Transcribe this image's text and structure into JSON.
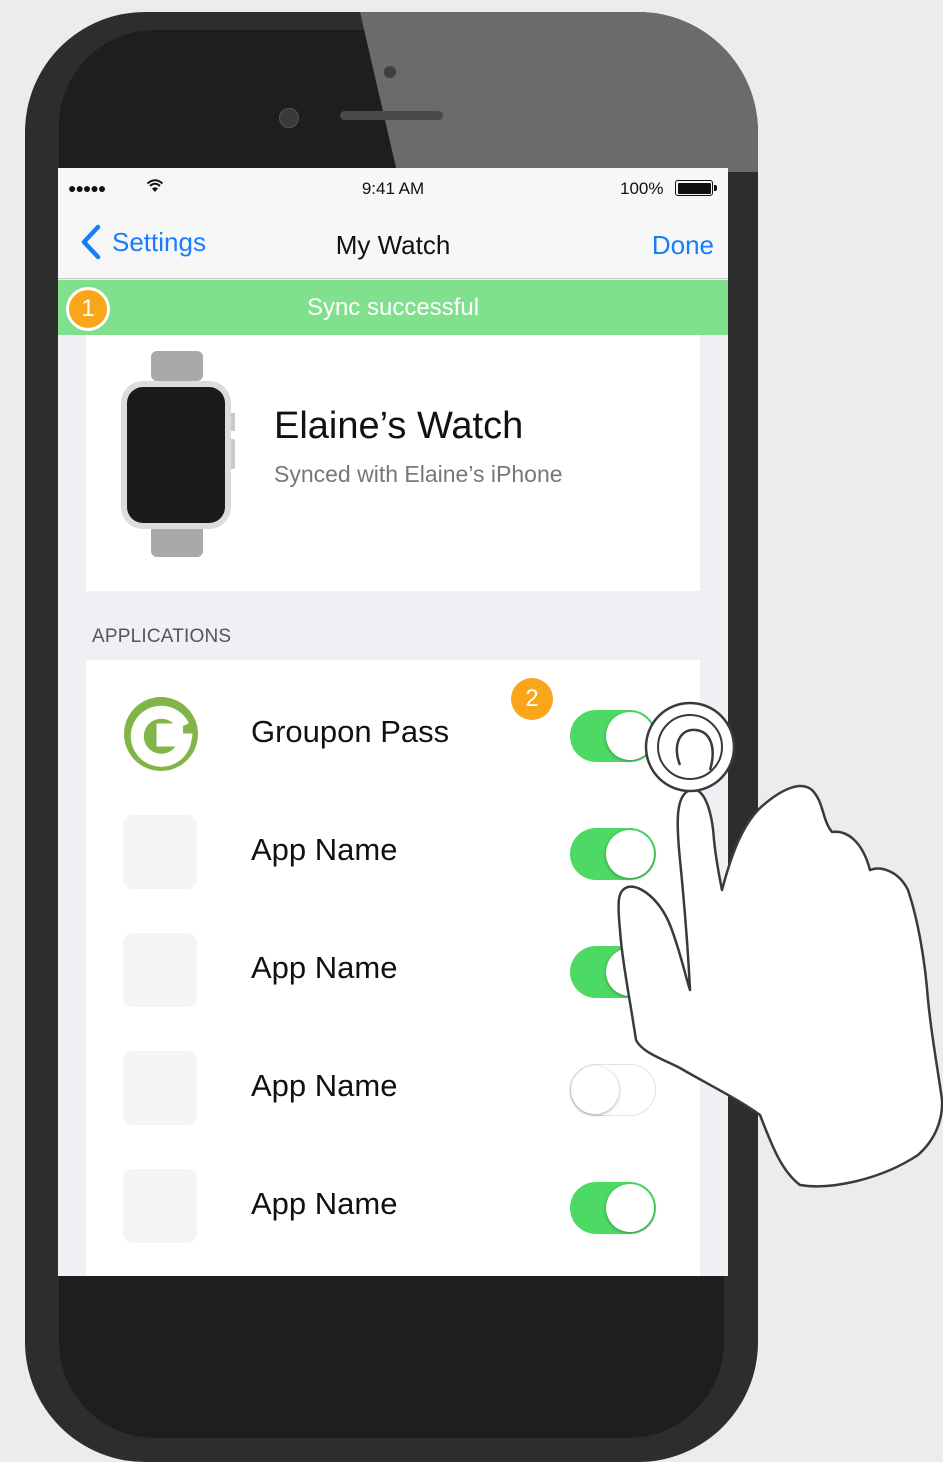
{
  "status_bar": {
    "signal": "●●●●●",
    "time": "9:41 AM",
    "battery_percent": "100%"
  },
  "nav": {
    "back_label": "Settings",
    "title": "My Watch",
    "done_label": "Done"
  },
  "banner": {
    "text": "Sync successful",
    "color": "#80e08e"
  },
  "badges": {
    "first": "1",
    "second": "2",
    "color": "#f9a61a"
  },
  "watch": {
    "name": "Elaine’s Watch",
    "subtitle": "Synced with Elaine’s iPhone"
  },
  "applications": {
    "header": "APPLICATIONS",
    "items": [
      {
        "name": "Groupon Pass",
        "enabled": true,
        "icon": "groupon-logo-icon"
      },
      {
        "name": "App Name",
        "enabled": true,
        "icon": "app-placeholder-icon"
      },
      {
        "name": "App Name",
        "enabled": true,
        "icon": "app-placeholder-icon"
      },
      {
        "name": "App Name",
        "enabled": false,
        "icon": "app-placeholder-icon"
      },
      {
        "name": "App Name",
        "enabled": true,
        "icon": "app-placeholder-icon"
      }
    ]
  },
  "colors": {
    "accent": "#157efb",
    "toggle_on": "#4cd964",
    "groupon_green": "#82b548"
  }
}
